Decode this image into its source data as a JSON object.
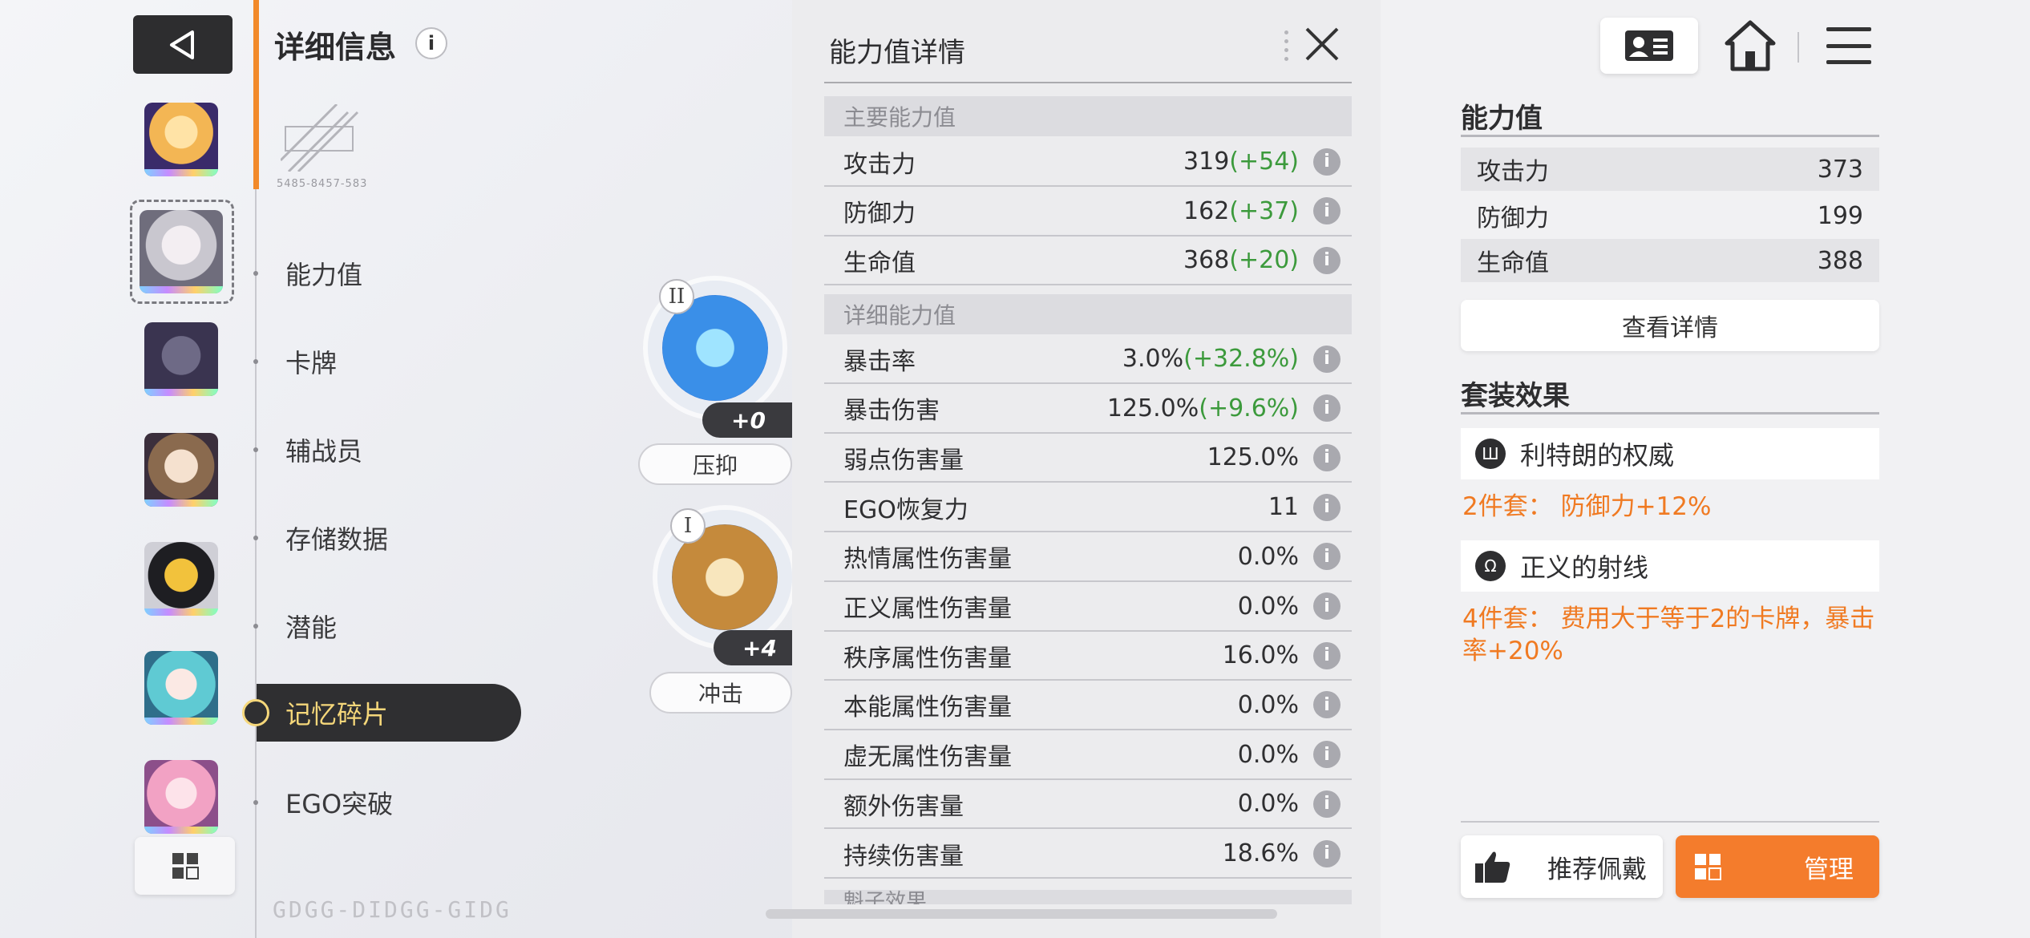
{
  "header": {
    "title": "详细信息",
    "info_icon": "i",
    "logo_caption": "5485-8457-583"
  },
  "nav": {
    "back_icon": "back-triangle-icon",
    "grid_icon": "grid-icon"
  },
  "menu": {
    "items": [
      {
        "label": "能力值"
      },
      {
        "label": "卡牌"
      },
      {
        "label": "辅战员"
      },
      {
        "label": "存储数据"
      },
      {
        "label": "潜能"
      },
      {
        "label": "记忆碎片",
        "active": true
      },
      {
        "label": "EGO突破"
      }
    ]
  },
  "watermark": "GDGG-DIDGG-GIDG",
  "shards": [
    {
      "roman": "II",
      "level": "+0",
      "name": "压抑"
    },
    {
      "roman": "I",
      "level": "+4",
      "name": "冲击"
    }
  ],
  "detail": {
    "title": "能力值详情",
    "main_header": "主要能力值",
    "main_stats": [
      {
        "label": "攻击力",
        "value": "319",
        "bonus": "(+54)"
      },
      {
        "label": "防御力",
        "value": "162",
        "bonus": "(+37)"
      },
      {
        "label": "生命值",
        "value": "368",
        "bonus": "(+20)"
      }
    ],
    "detail_header": "详细能力值",
    "detail_stats": [
      {
        "label": "暴击率",
        "value": "3.0%",
        "bonus": "(+32.8%)"
      },
      {
        "label": "暴击伤害",
        "value": "125.0%",
        "bonus": "(+9.6%)"
      },
      {
        "label": "弱点伤害量",
        "value": "125.0%",
        "bonus": ""
      },
      {
        "label": "EGO恢复力",
        "value": "11",
        "bonus": ""
      },
      {
        "label": "热情属性伤害量",
        "value": "0.0%",
        "bonus": ""
      },
      {
        "label": "正义属性伤害量",
        "value": "0.0%",
        "bonus": ""
      },
      {
        "label": "秩序属性伤害量",
        "value": "16.0%",
        "bonus": ""
      },
      {
        "label": "本能属性伤害量",
        "value": "0.0%",
        "bonus": ""
      },
      {
        "label": "虚无属性伤害量",
        "value": "0.0%",
        "bonus": ""
      },
      {
        "label": "额外伤害量",
        "value": "0.0%",
        "bonus": ""
      },
      {
        "label": "持续伤害量",
        "value": "18.6%",
        "bonus": ""
      }
    ],
    "next_header_partial": "魁子效果"
  },
  "right": {
    "stats_title": "能力值",
    "stats": [
      {
        "label": "攻击力",
        "value": "373"
      },
      {
        "label": "防御力",
        "value": "199"
      },
      {
        "label": "生命值",
        "value": "388"
      }
    ],
    "view_detail": "查看详情",
    "set_title": "套装效果",
    "sets": [
      {
        "name": "利特朗的权威",
        "effect": "2件套： 防御力+12%"
      },
      {
        "name": "正义的射线",
        "effect": "4件套： 费用大于等于2的卡牌，暴击率+20%"
      }
    ],
    "recommend": "推荐佩戴",
    "manage": "管理"
  },
  "colors": {
    "accent": "#f47c2c",
    "bonus_green": "#3c9a3c",
    "set_effect": "#f07a22",
    "active_text": "#f5d77a"
  }
}
